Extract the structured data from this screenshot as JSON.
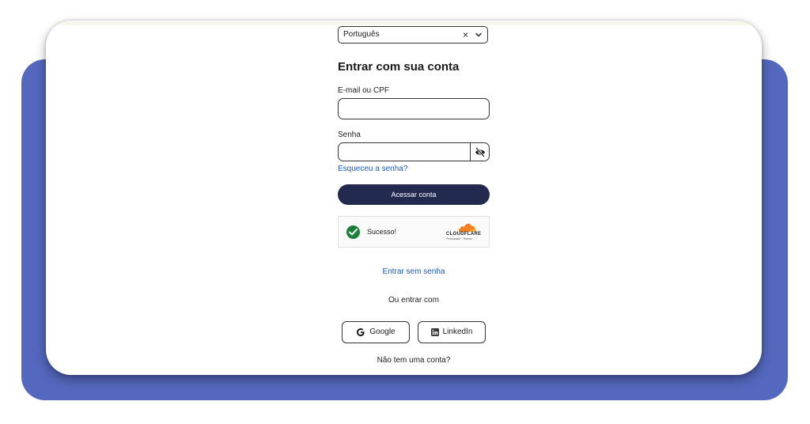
{
  "language_select": {
    "value": "Português",
    "clear_symbol": "×"
  },
  "login": {
    "title": "Entrar com sua conta",
    "email_label": "E-mail ou CPF",
    "email_value": "",
    "password_label": "Senha",
    "password_value": "",
    "forgot_password": "Esqueceu a senha?",
    "submit": "Acessar conta"
  },
  "captcha": {
    "status": "Sucesso!",
    "provider": "CLOUDFLARE",
    "provider_links": "Privacidade · Termos"
  },
  "passwordless_link": "Entrar sem senha",
  "or_sign_in_with": "Ou entrar com",
  "social": {
    "google": "Google",
    "linkedin": "LinkedIn"
  },
  "no_account": "Não tem uma conta?",
  "colors": {
    "backdrop": "#5468bf",
    "primary_button": "#222a4f",
    "link": "#1a5bb8",
    "success": "#188038",
    "cloudflare_orange": "#f48120"
  },
  "icons": [
    "chevron-down-icon",
    "clear-icon",
    "eye-off-icon",
    "checkmark-icon",
    "cloudflare-logo",
    "google-icon",
    "linkedin-icon"
  ]
}
